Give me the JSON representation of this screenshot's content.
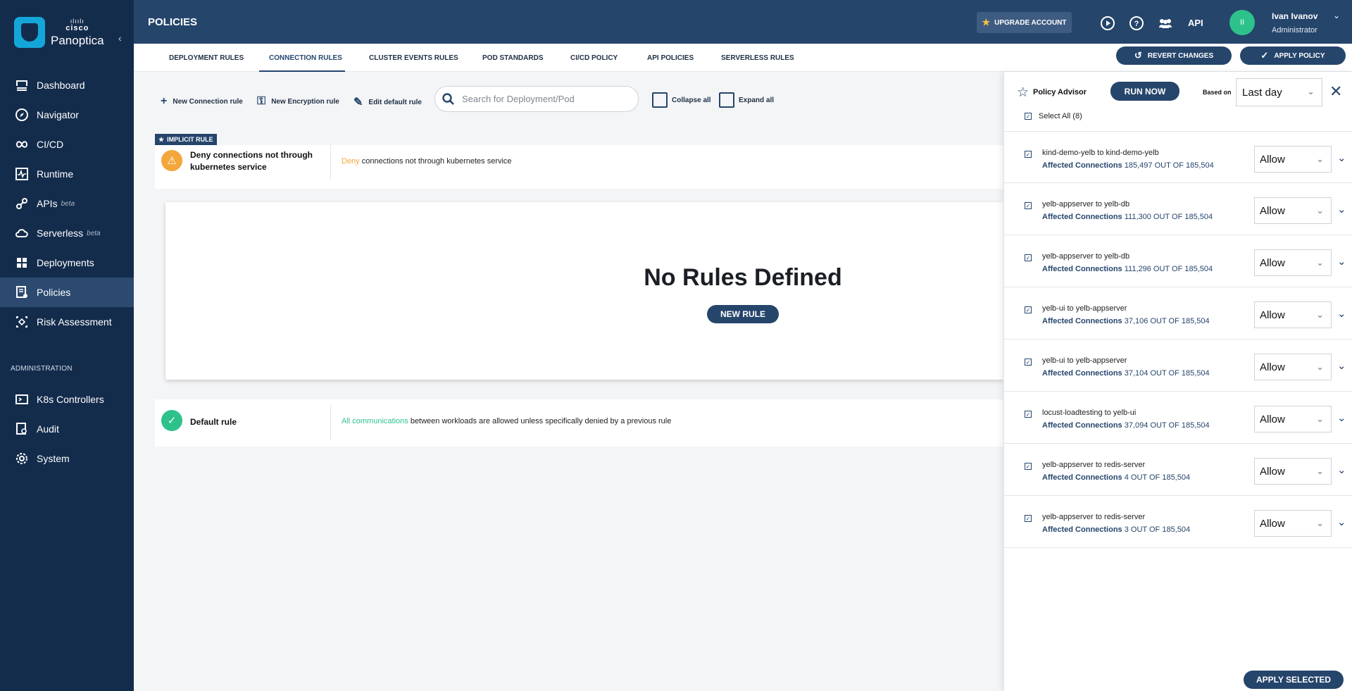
{
  "brand": {
    "vendor": "cisco",
    "product": "Panoptica",
    "accent": "#15a6d9"
  },
  "sidebar": {
    "items": [
      {
        "label": "Dashboard",
        "icon": "dashboard-icon"
      },
      {
        "label": "Navigator",
        "icon": "compass-icon"
      },
      {
        "label": "CI/CD",
        "icon": "cicd-icon"
      },
      {
        "label": "Runtime",
        "icon": "runtime-icon"
      },
      {
        "label": "APIs",
        "badge": "beta",
        "icon": "api-icon"
      },
      {
        "label": "Serverless",
        "badge": "beta",
        "icon": "cloud-icon"
      },
      {
        "label": "Deployments",
        "icon": "grid-icon"
      },
      {
        "label": "Policies",
        "icon": "policy-icon",
        "active": true
      },
      {
        "label": "Risk Assessment",
        "icon": "risk-icon"
      }
    ],
    "admin_section": "ADMINISTRATION",
    "admin_items": [
      {
        "label": "K8s Controllers",
        "icon": "k8s-icon"
      },
      {
        "label": "Audit",
        "icon": "audit-icon"
      },
      {
        "label": "System",
        "icon": "gear-icon"
      }
    ]
  },
  "header": {
    "title": "POLICIES",
    "upgrade": "UPGRADE ACCOUNT",
    "api": "API",
    "user": {
      "initials": "II",
      "name": "Ivan Ivanov",
      "role": "Administrator"
    }
  },
  "tabs": [
    "DEPLOYMENT RULES",
    "CONNECTION RULES",
    "CLUSTER EVENTS RULES",
    "POD STANDARDS",
    "CI/CD POLICY",
    "API POLICIES",
    "SERVERLESS RULES"
  ],
  "actions": {
    "revert": "REVERT CHANGES",
    "apply": "APPLY POLICY"
  },
  "toolbar": {
    "new_connection": "New Connection rule",
    "new_encryption": "New Encryption rule",
    "edit_default": "Edit default rule",
    "search_placeholder": "Search for Deployment/Pod",
    "collapse": "Collapse all",
    "expand": "Expand all"
  },
  "implicit_rule": {
    "badge": "IMPLICIT RULE",
    "title_line1": "Deny connections not through",
    "title_line2": "kubernetes service",
    "desc_highlight": "Deny",
    "desc_rest": " connections not through kubernetes service"
  },
  "empty": {
    "title": "No Rules Defined",
    "button": "NEW RULE"
  },
  "default_rule": {
    "title": "Default rule",
    "desc_highlight": "All communications",
    "desc_rest": " between workloads are allowed unless specifically denied by a previous rule"
  },
  "advisor": {
    "title": "Policy Advisor",
    "run": "RUN NOW",
    "based_on": "Based on",
    "period": "Last day",
    "select_all": "Select All (8)",
    "affected_label": "Affected Connections",
    "apply_selected": "APPLY SELECTED",
    "rows": [
      {
        "title": "kind-demo-yelb to kind-demo-yelb",
        "count": "185,497 OUT OF 185,504",
        "action": "Allow"
      },
      {
        "title": "yelb-appserver to yelb-db",
        "count": "111,300 OUT OF 185,504",
        "action": "Allow"
      },
      {
        "title": "yelb-appserver to yelb-db",
        "count": "111,296 OUT OF 185,504",
        "action": "Allow"
      },
      {
        "title": "yelb-ui to yelb-appserver",
        "count": "37,106 OUT OF 185,504",
        "action": "Allow"
      },
      {
        "title": "yelb-ui to yelb-appserver",
        "count": "37,104 OUT OF 185,504",
        "action": "Allow"
      },
      {
        "title": "locust-loadtesting to yelb-ui",
        "count": "37,094 OUT OF 185,504",
        "action": "Allow"
      },
      {
        "title": "yelb-appserver to redis-server",
        "count": "4 OUT OF 185,504",
        "action": "Allow"
      },
      {
        "title": "yelb-appserver to redis-server",
        "count": "3 OUT OF 185,504",
        "action": "Allow"
      }
    ]
  }
}
